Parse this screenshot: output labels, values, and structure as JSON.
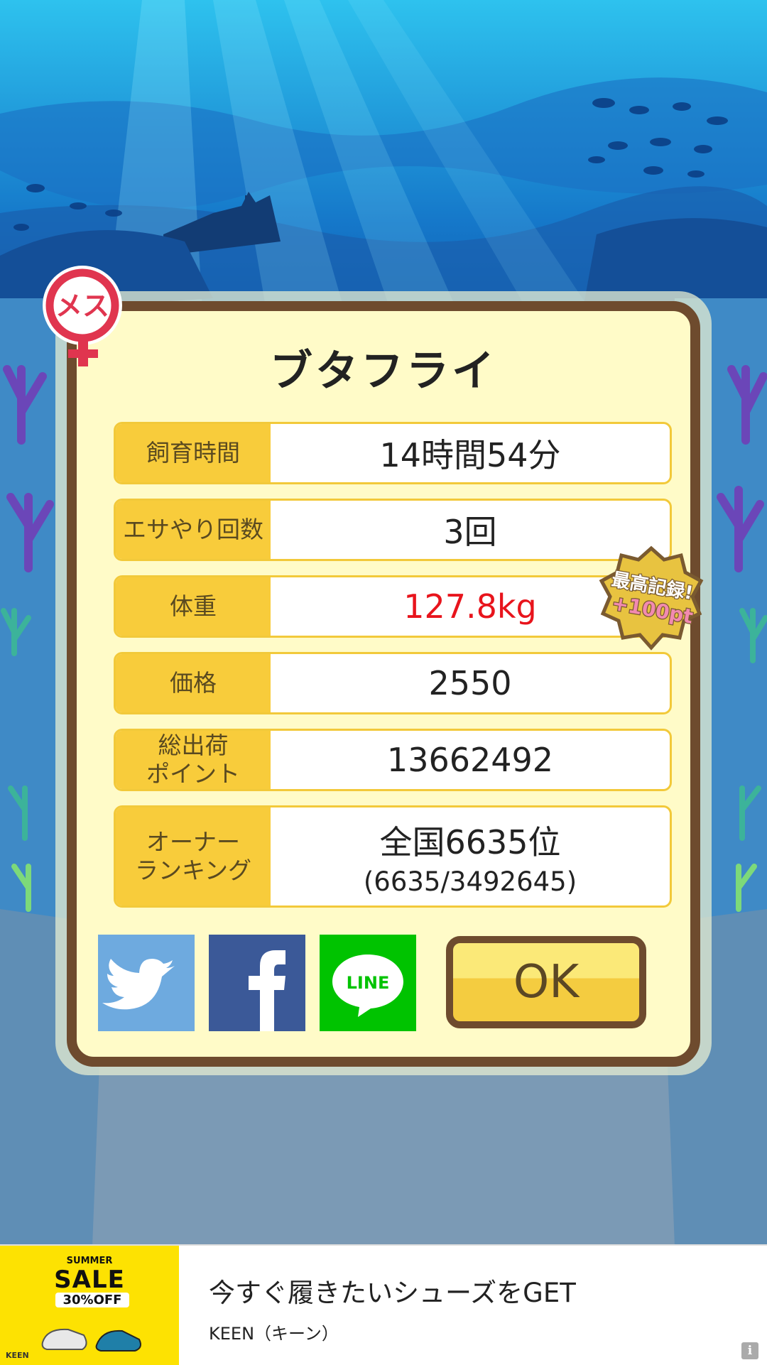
{
  "dialog": {
    "title": "ブタフライ",
    "sex_badge": "メス",
    "record_badge": {
      "line1": "最高記録!",
      "line2": "+100pt"
    },
    "rows": [
      {
        "label": "飼育時間",
        "value": "14時間54分"
      },
      {
        "label": "エサやり回数",
        "value": "3回"
      },
      {
        "label": "体重",
        "value": "127.8kg",
        "value_color": "#e8141c"
      },
      {
        "label": "価格",
        "value": "2550"
      },
      {
        "label_line1": "総出荷",
        "label_line2": "ポイント",
        "value": "13662492"
      },
      {
        "label_line1": "オーナー",
        "label_line2": "ランキング",
        "value": "全国6635位",
        "sub_value": "(6635/3492645)"
      }
    ],
    "share": {
      "line_label": "LINE"
    },
    "ok_label": "OK"
  },
  "ad": {
    "image": {
      "summer": "SUMMER",
      "sale": "SALE",
      "off": "30%OFF",
      "logo": "KEEN"
    },
    "headline": "今すぐ履きたいシューズをGET",
    "brand": "KEEN（キーン）",
    "info": "i"
  },
  "colors": {
    "dialog_border": "#6e4b2e",
    "dialog_bg": "#fffbc8",
    "label_bg": "#f8cc3b",
    "twitter": "#6eaadf",
    "facebook": "#3b5998",
    "line": "#00c300",
    "highlight": "#e8141c"
  }
}
